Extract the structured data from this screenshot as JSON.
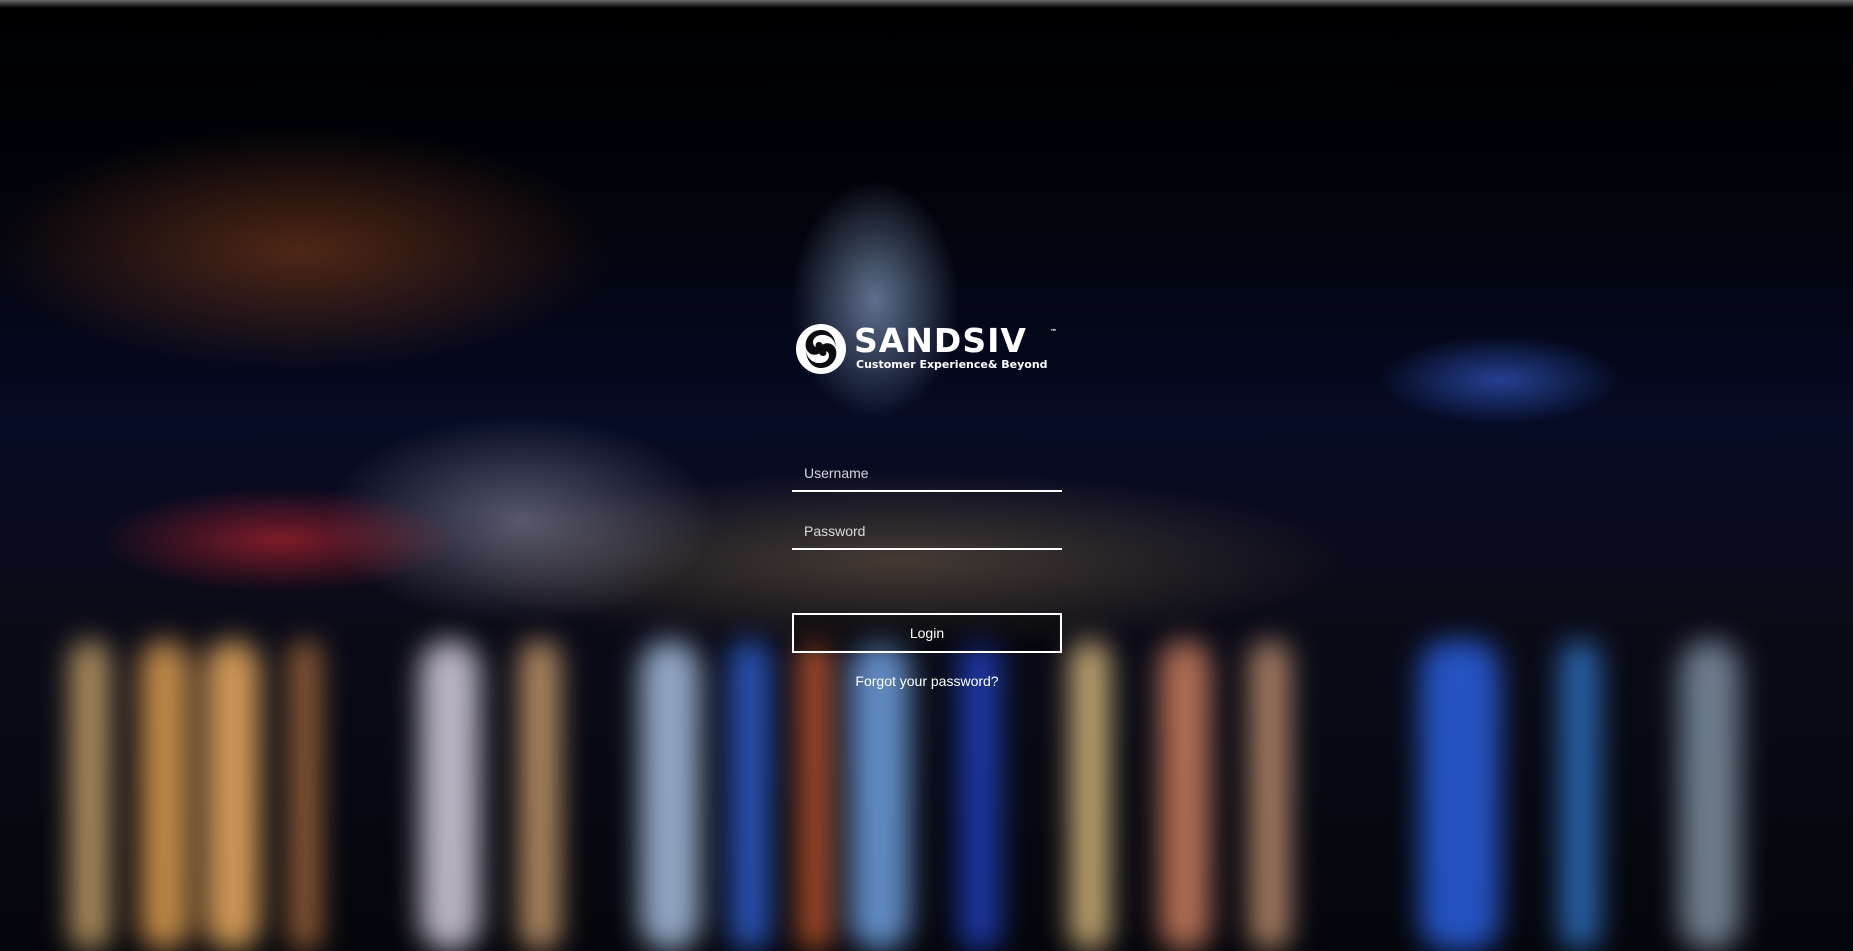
{
  "logo": {
    "wordmark": "SANDSIV",
    "trademark": "™",
    "tagline": "Customer Experience& Beyond",
    "mark_icon": "sandsiv-swirl-icon"
  },
  "login_form": {
    "username_placeholder": "Username",
    "username_value": "",
    "password_placeholder": "Password",
    "password_value": "",
    "login_label": "Login",
    "forgot_password_label": "Forgot your password?"
  },
  "colors": {
    "text": "#ffffff",
    "field_underline": "#ffffff",
    "button_border": "#ffffff",
    "background_dark": "#05060c"
  }
}
